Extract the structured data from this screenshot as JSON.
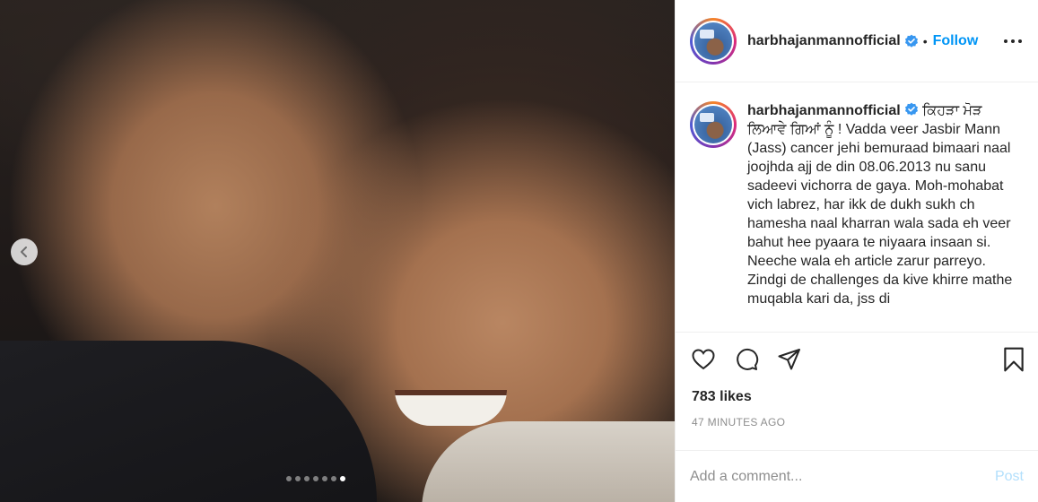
{
  "post": {
    "username": "harbhajanmannofficial",
    "follow_label": "Follow",
    "bullet": "•",
    "carousel": {
      "slide_count": 7,
      "active_index": 6
    }
  },
  "caption": {
    "username": "harbhajanmannofficial",
    "text": "ਕਿਹੜਾ ਮੋੜ ਲਿਆਵੇ ਗਿਆਂ ਨੂੰ ! Vadda veer Jasbir Mann (Jass) cancer jehi bemuraad bimaari naal joojhda ajj de din 08.06.2013 nu sanu sadeevi vichorra de gaya. Moh-mohabat vich labrez, har ikk de dukh sukh ch hamesha naal kharran wala sada eh veer bahut hee pyaara te niyaara insaan si. Neeche wala eh article zarur parreyo. Zindgi de challenges da kive khirre mathe muqabla kari da, jss di"
  },
  "stats": {
    "likes": "783 likes",
    "timestamp": "47 MINUTES AGO"
  },
  "comment": {
    "placeholder": "Add a comment...",
    "post_label": "Post"
  },
  "colors": {
    "accent": "#0095f6",
    "post_disabled": "#b2dffc",
    "muted": "#8e8e8e"
  }
}
